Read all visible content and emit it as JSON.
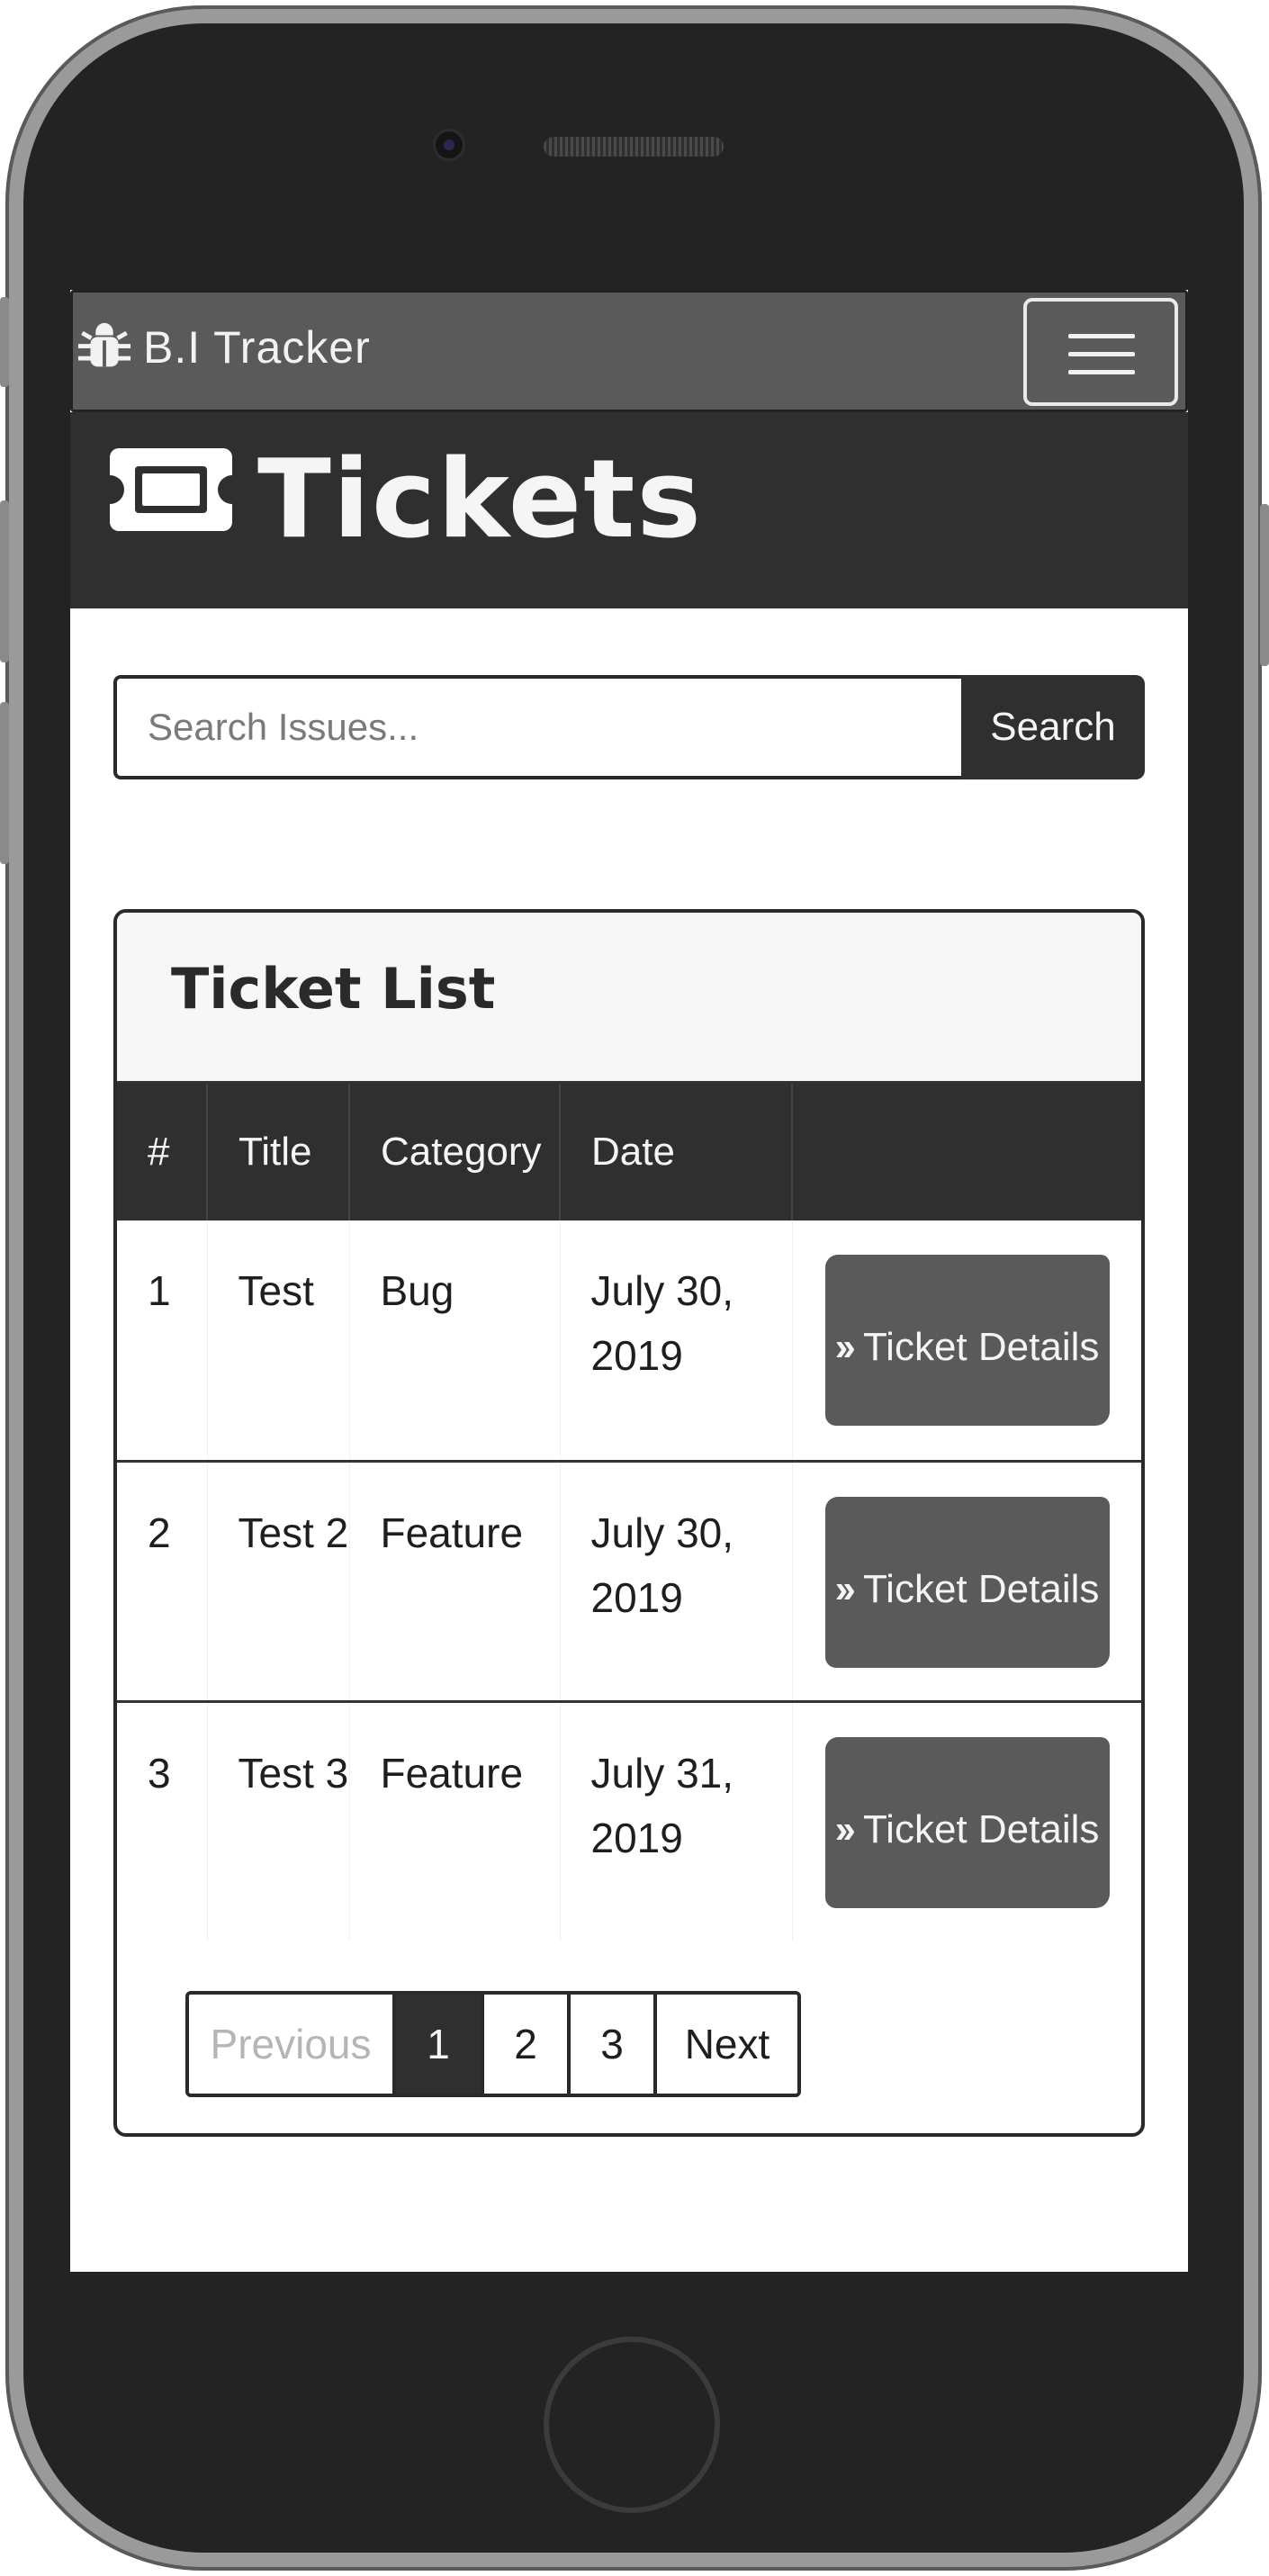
{
  "navbar": {
    "brand": "B.I Tracker",
    "brand_icon": "bug-icon",
    "toggler_icon": "hamburger-menu-icon"
  },
  "hero": {
    "title": "Tickets",
    "icon": "ticket-icon"
  },
  "search": {
    "placeholder": "Search Issues...",
    "button_label": "Search"
  },
  "ticket_list": {
    "title": "Ticket List",
    "columns": [
      "#",
      "Title",
      "Category",
      "Date",
      ""
    ],
    "rows": [
      {
        "id": "1",
        "title": "Test",
        "category": "Bug",
        "date": "July 30, 2019",
        "action": "Ticket Details"
      },
      {
        "id": "2",
        "title": "Test 2",
        "category": "Feature",
        "date": "July 30, 2019",
        "action": "Ticket Details"
      },
      {
        "id": "3",
        "title": "Test 3",
        "category": "Feature",
        "date": "July 31, 2019",
        "action": "Ticket Details"
      }
    ]
  },
  "pagination": {
    "previous": "Previous",
    "pages": [
      "1",
      "2",
      "3"
    ],
    "active_page": "1",
    "next": "Next"
  },
  "colors": {
    "navbar_bg": "#5a5a5a",
    "hero_bg": "#2f2f2f",
    "button_bg": "#5a5a5a",
    "table_head_bg": "#2f2f2f"
  }
}
